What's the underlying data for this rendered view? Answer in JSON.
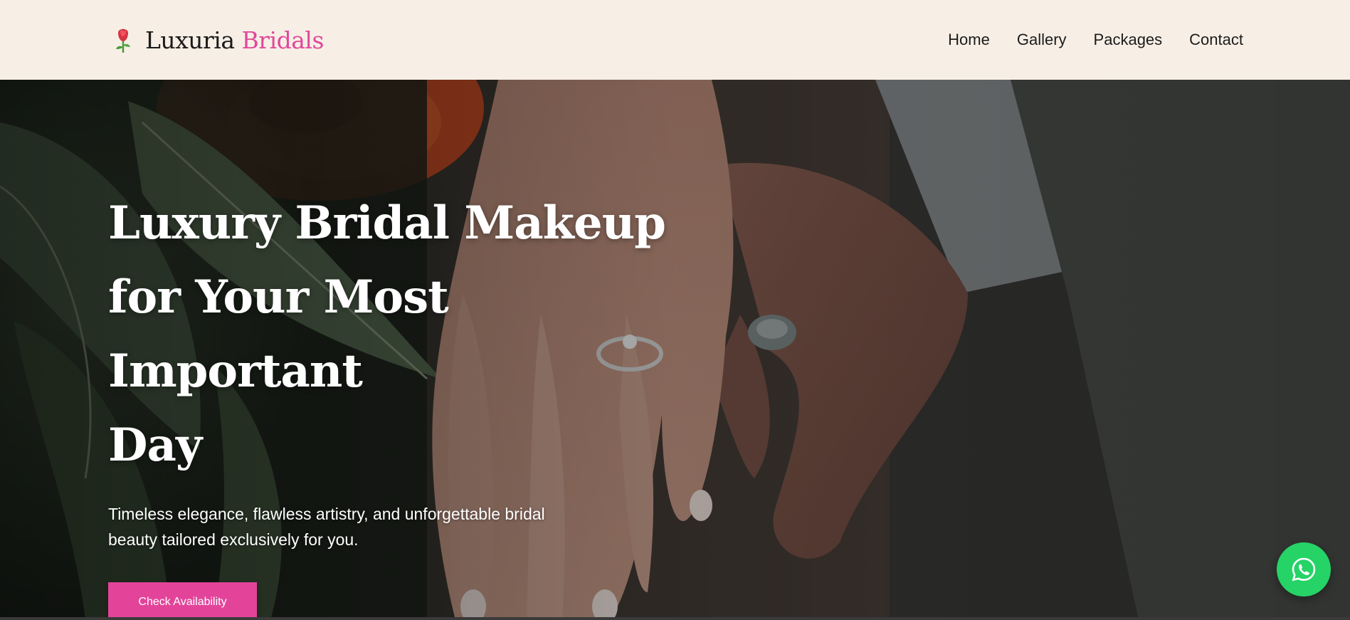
{
  "brand": {
    "name_part1": "Luxuria",
    "name_part2": "Bridals",
    "icon": "rose-icon",
    "accent_color": "#e1489a"
  },
  "nav": {
    "items": [
      {
        "label": "Home"
      },
      {
        "label": "Gallery"
      },
      {
        "label": "Packages"
      },
      {
        "label": "Contact"
      }
    ]
  },
  "hero": {
    "title_line1": "Luxury Bridal Makeup",
    "title_line2": "for Your Most Important",
    "title_line3": "Day",
    "subtitle_line1": "Timeless elegance, flawless artistry, and unforgettable bridal",
    "subtitle_line2": "beauty tailored exclusively for you.",
    "cta_label": "Check Availability",
    "cta_color": "#e3449a"
  },
  "floating": {
    "whatsapp_icon": "whatsapp-icon",
    "whatsapp_color": "#25d366"
  },
  "colors": {
    "header_bg": "#f7efe6"
  }
}
